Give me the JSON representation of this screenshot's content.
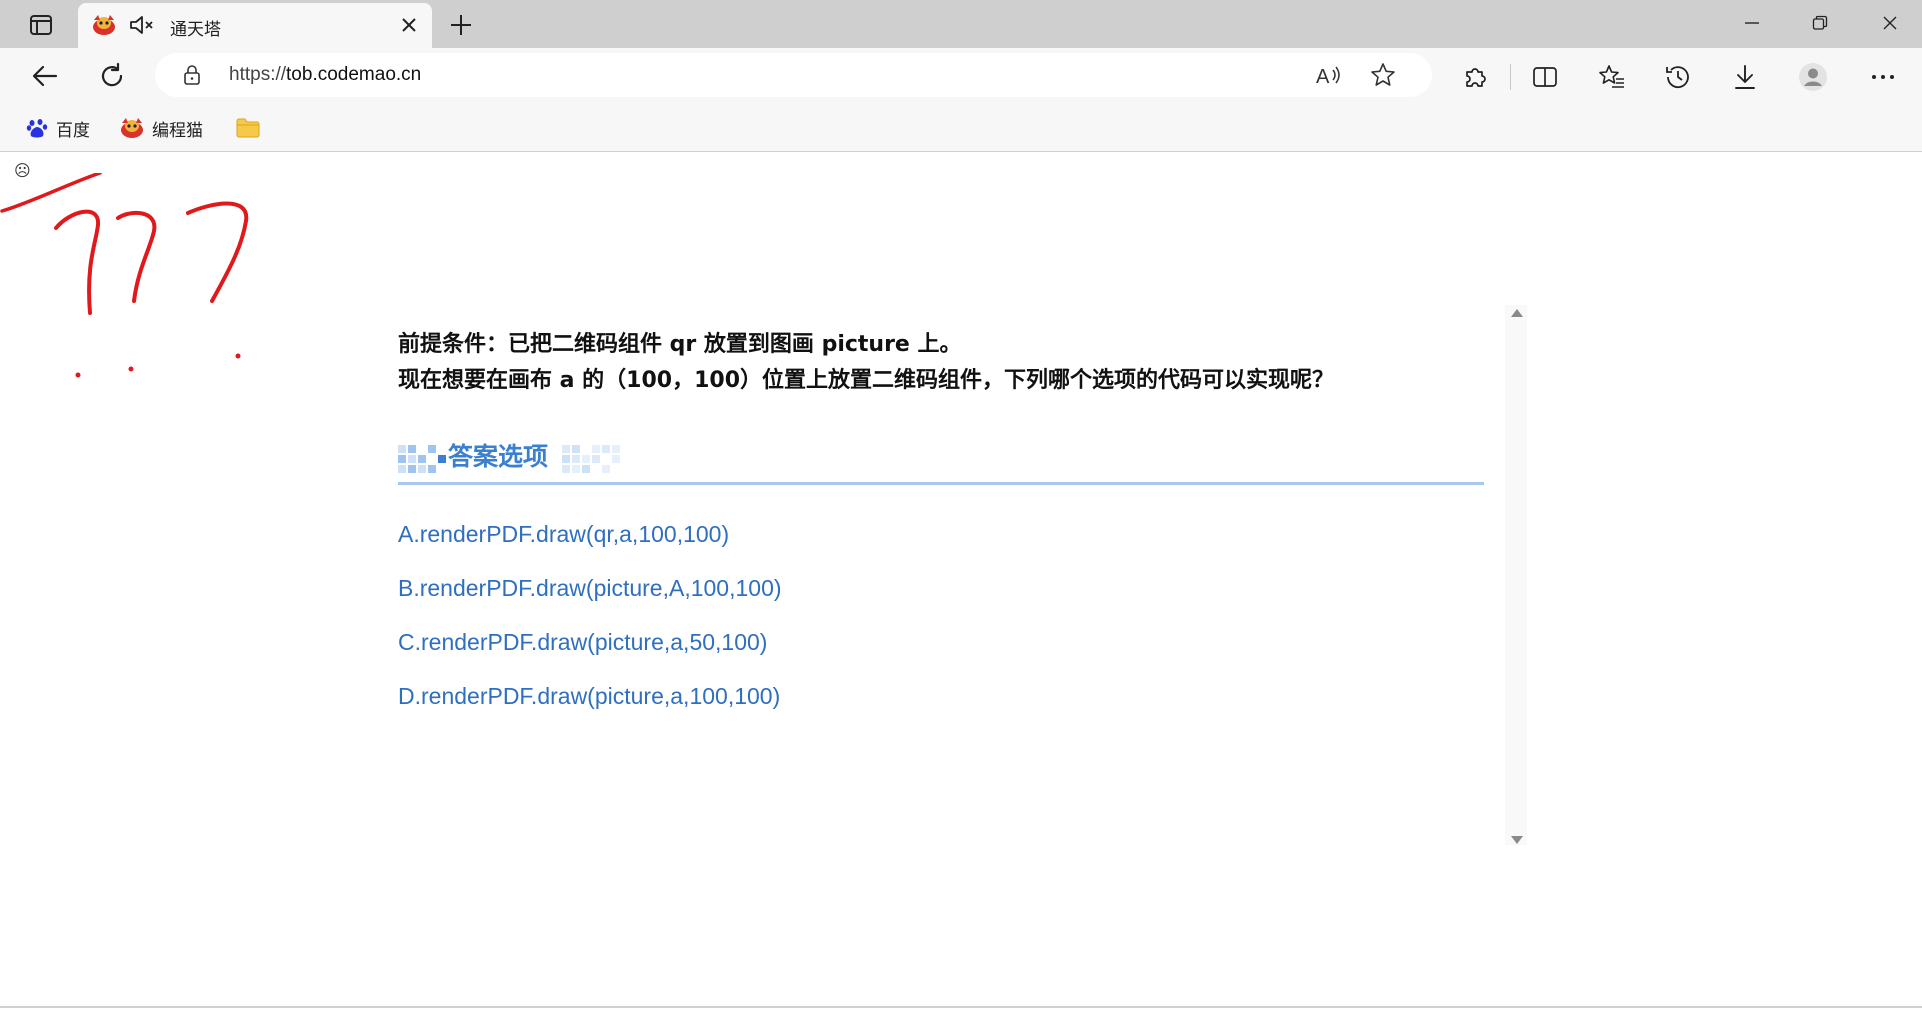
{
  "browser": {
    "tab": {
      "title": "通天塔"
    },
    "address": {
      "url_scheme": "https://",
      "url_host": "tob.codemao.cn"
    },
    "bookmarks": [
      {
        "label": "百度",
        "icon": "baidu-paw-icon"
      },
      {
        "label": "编程猫",
        "icon": "codemao-icon"
      },
      {
        "label": "",
        "icon": "folder-icon"
      }
    ],
    "colors": {
      "accent": "#3b7fd1",
      "option_text": "#2f6fbf",
      "annotation": "#e0191d"
    }
  },
  "page": {
    "smiley": "☹",
    "question": {
      "line1": "前提条件：已把二维码组件 qr 放置到图画 picture 上。",
      "line2": "现在想要在画布 a 的（100，100）位置上放置二维码组件，下列哪个选项的代码可以实现呢？"
    },
    "section_title": "答案选项",
    "options": [
      "A.renderPDF.draw(qr,a,100,100)",
      "B.renderPDF.draw(picture,A,100,100)",
      "C.renderPDF.draw(picture,a,50,100)",
      "D.renderPDF.draw(picture,a,100,100)"
    ]
  }
}
